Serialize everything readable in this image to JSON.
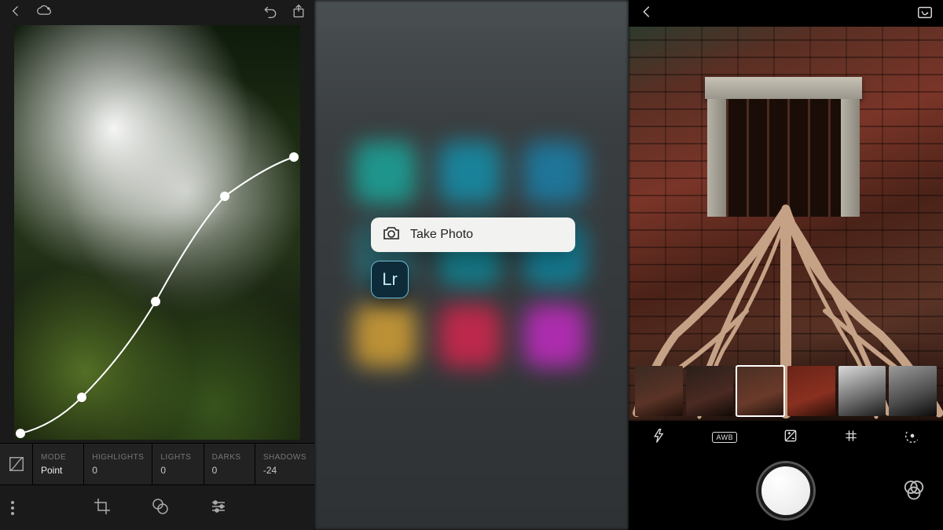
{
  "left": {
    "toneRow": {
      "modeLabel": "MODE",
      "modeValue": "Point",
      "highlightsLabel": "HIGHLIGHTS",
      "highlightsValue": "0",
      "lightsLabel": "LIGHTS",
      "lightsValue": "0",
      "darksLabel": "DARKS",
      "darksValue": "0",
      "shadowsLabel": "SHADOWS",
      "shadowsValue": "-24"
    }
  },
  "middle": {
    "quickActionLabel": "Take Photo",
    "appBadge": "Lr"
  },
  "right": {
    "awbLabel": "AWB",
    "filterSelectedIndex": 2
  }
}
